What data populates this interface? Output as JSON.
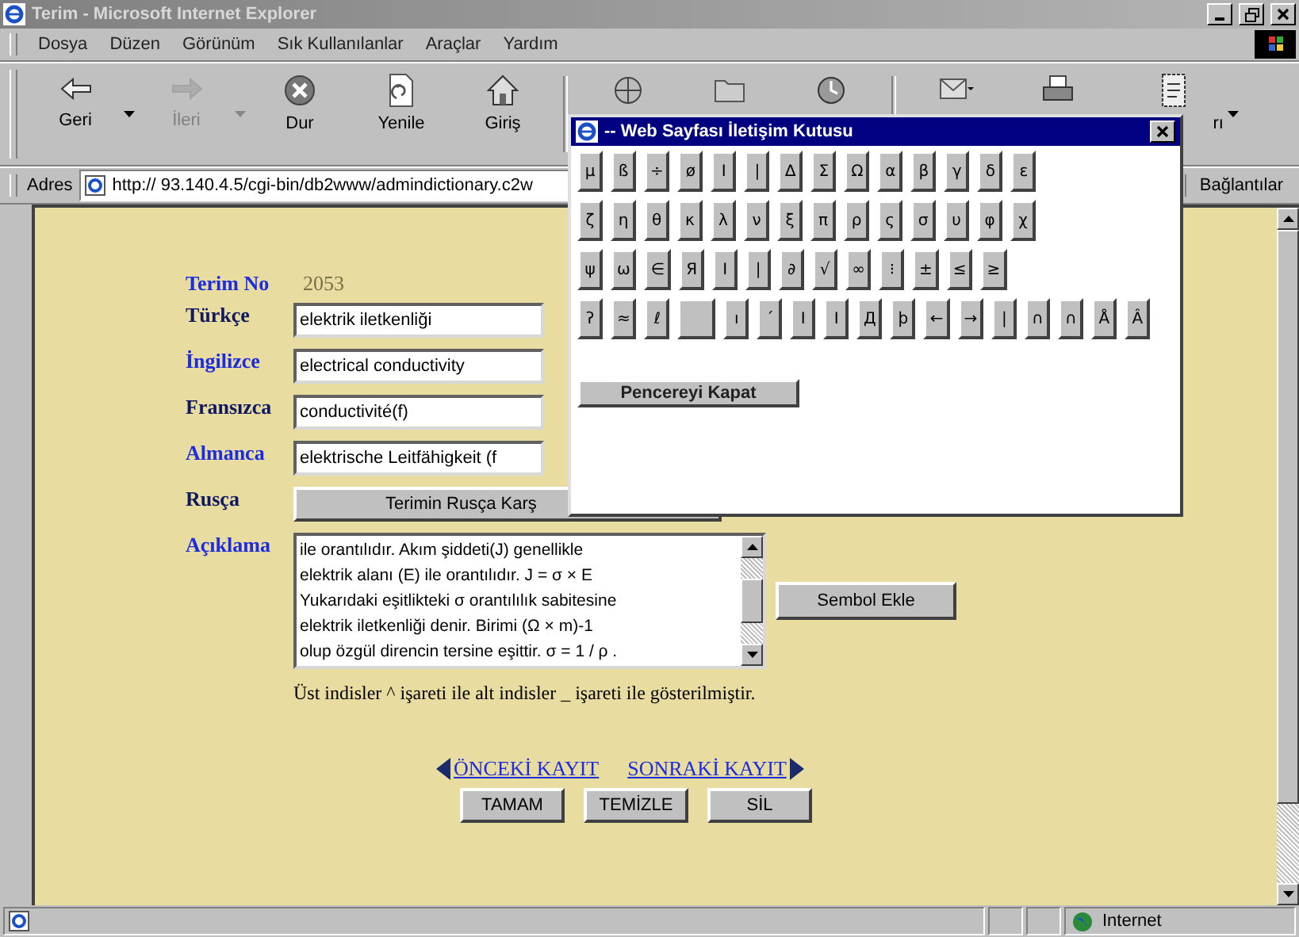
{
  "window": {
    "title": "Terim - Microsoft Internet Explorer"
  },
  "menu": [
    "Dosya",
    "Düzen",
    "Görünüm",
    "Sık Kullanılanlar",
    "Araçlar",
    "Yardım"
  ],
  "toolbar": [
    {
      "kind": "back",
      "label": "Geri",
      "dropdown": true,
      "disabled": false
    },
    {
      "kind": "forward",
      "label": "İleri",
      "dropdown": true,
      "disabled": true
    },
    {
      "kind": "stop",
      "label": "Dur",
      "dropdown": false,
      "disabled": false
    },
    {
      "kind": "refresh",
      "label": "Yenile",
      "dropdown": false,
      "disabled": false
    },
    {
      "kind": "home",
      "label": "Giriş",
      "dropdown": false,
      "disabled": false
    },
    {
      "kind": "separator"
    },
    {
      "kind": "search",
      "dropdown": false,
      "disabled": false
    },
    {
      "kind": "favorites",
      "dropdown": false,
      "disabled": false
    },
    {
      "kind": "history",
      "dropdown": false,
      "disabled": false
    },
    {
      "kind": "separator"
    },
    {
      "kind": "mail",
      "dropdown": false,
      "disabled": false
    },
    {
      "kind": "print",
      "dropdown": false,
      "disabled": false
    },
    {
      "kind": "edit",
      "label": "rı",
      "dropdown": true,
      "disabled": false
    }
  ],
  "address": {
    "label": "Adres",
    "value": "http:// 93.140.4.5/cgi-bin/db2www/admindictionary.c2w"
  },
  "links_label": "Bağlantılar",
  "form": {
    "term_no_label": "Terim No",
    "term_no": "2053",
    "fields": [
      {
        "label": "Türkçe",
        "link": false,
        "kind": "input",
        "value": "elektrik iletkenliği"
      },
      {
        "label": "İngilizce",
        "link": true,
        "kind": "input",
        "value": "electrical conductivity"
      },
      {
        "label": "Fransızca",
        "link": false,
        "kind": "input",
        "value": "conductivité(f)"
      },
      {
        "label": "Almanca",
        "link": true,
        "kind": "input",
        "value": "elektrische Leitfähigkeit (f"
      },
      {
        "label": "Rusça",
        "link": false,
        "kind": "button",
        "value": "Terimin Rusça Karş"
      },
      {
        "label": "Açıklama",
        "link": true,
        "kind": "textarea",
        "lines": [
          "ile orantılıdır. Akım şiddeti(J) genellikle",
          "elektrik alanı (E) ile orantılıdır. J = σ × E",
          "Yukarıdaki eşitlikteki σ orantılılık sabitesine",
          "elektrik iletkenliği denir. Birimi (Ω × m)-1",
          "olup özgül direncin tersine eşittir. σ = 1 / ρ ."
        ]
      }
    ],
    "symbol_button": "Sembol Ekle",
    "note": "Üst indisler ^ işareti ile alt indisler _ işareti ile gösterilmiştir.",
    "nav": {
      "prev": "ÖNCEKİ KAYIT",
      "next": "SONRAKİ KAYIT"
    },
    "buttons": [
      "TAMAM",
      "TEMİZLE",
      "SİL"
    ]
  },
  "dialog": {
    "title": "-- Web Sayfası İletişim Kutusu",
    "rows": [
      [
        "µ",
        "ß",
        "÷",
        "ø",
        "I",
        "|",
        "∆",
        "Σ",
        "Ω",
        "α",
        "β",
        "γ",
        "δ",
        "ε"
      ],
      [
        "ζ",
        "η",
        "θ",
        "κ",
        "λ",
        "ν",
        "ξ",
        "π",
        "ρ",
        "ς",
        "σ",
        "υ",
        "φ",
        "χ"
      ],
      [
        "ψ",
        "ω",
        "∈",
        "Я",
        "I",
        "|",
        "∂",
        "√",
        "∞",
        "⁝",
        "±",
        "≤",
        "≥"
      ],
      [
        "ʔ",
        "≈",
        "ℓ",
        {
          "kind": "blank"
        },
        "ı",
        "´",
        "I",
        "I",
        "Д",
        "þ",
        "←",
        "→",
        "|",
        "∩",
        "∩",
        "Å",
        "Â"
      ]
    ],
    "close_button": "Pencereyi Kapat"
  },
  "status": {
    "zone": "Internet"
  }
}
